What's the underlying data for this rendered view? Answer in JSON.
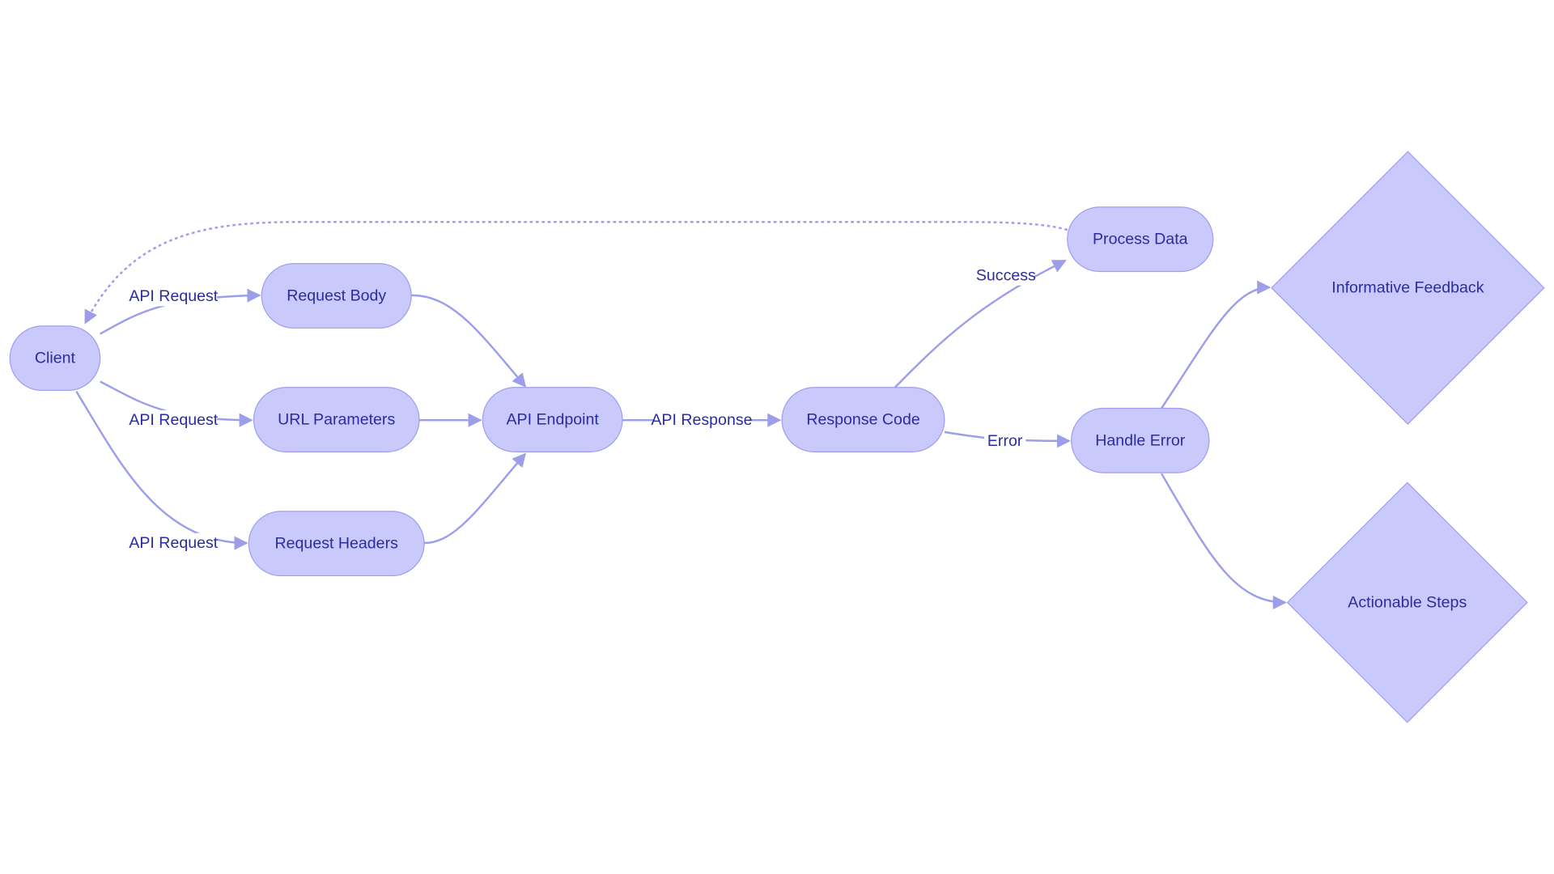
{
  "colors": {
    "node_fill": "#c9cafb",
    "node_stroke": "#9d9ef0",
    "edge": "#9c9eea",
    "text": "#2b2ca0"
  },
  "nodes": [
    {
      "id": "client",
      "label": "Client",
      "shape": "rounded"
    },
    {
      "id": "request_body",
      "label": "Request Body",
      "shape": "rounded"
    },
    {
      "id": "url_parameters",
      "label": "URL Parameters",
      "shape": "rounded"
    },
    {
      "id": "request_headers",
      "label": "Request Headers",
      "shape": "rounded"
    },
    {
      "id": "api_endpoint",
      "label": "API Endpoint",
      "shape": "rounded"
    },
    {
      "id": "response_code",
      "label": "Response Code",
      "shape": "rounded"
    },
    {
      "id": "process_data",
      "label": "Process Data",
      "shape": "rounded"
    },
    {
      "id": "handle_error",
      "label": "Handle Error",
      "shape": "rounded"
    },
    {
      "id": "informative_feedback",
      "label": "Informative Feedback",
      "shape": "diamond"
    },
    {
      "id": "actionable_steps",
      "label": "Actionable Steps",
      "shape": "diamond"
    }
  ],
  "edges": [
    {
      "from": "client",
      "to": "request_body",
      "label": "API Request",
      "style": "solid"
    },
    {
      "from": "client",
      "to": "url_parameters",
      "label": "API Request",
      "style": "solid"
    },
    {
      "from": "client",
      "to": "request_headers",
      "label": "API Request",
      "style": "solid"
    },
    {
      "from": "request_body",
      "to": "api_endpoint",
      "label": "",
      "style": "solid"
    },
    {
      "from": "url_parameters",
      "to": "api_endpoint",
      "label": "",
      "style": "solid"
    },
    {
      "from": "request_headers",
      "to": "api_endpoint",
      "label": "",
      "style": "solid"
    },
    {
      "from": "api_endpoint",
      "to": "response_code",
      "label": "API Response",
      "style": "solid"
    },
    {
      "from": "response_code",
      "to": "process_data",
      "label": "Success",
      "style": "solid"
    },
    {
      "from": "response_code",
      "to": "handle_error",
      "label": "Error",
      "style": "solid"
    },
    {
      "from": "handle_error",
      "to": "informative_feedback",
      "label": "",
      "style": "solid"
    },
    {
      "from": "handle_error",
      "to": "actionable_steps",
      "label": "",
      "style": "solid"
    },
    {
      "from": "process_data",
      "to": "client",
      "label": "",
      "style": "dotted"
    }
  ]
}
